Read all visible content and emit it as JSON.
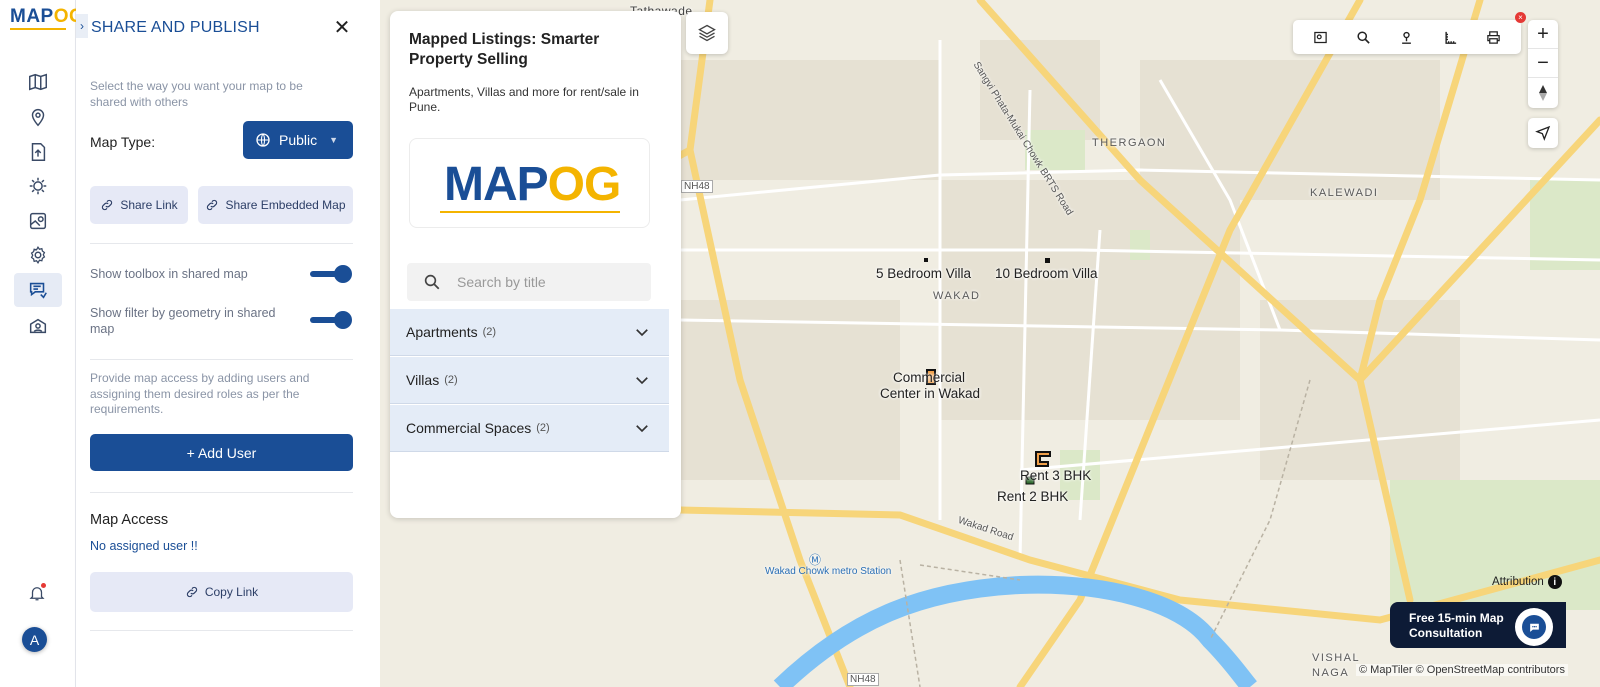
{
  "rail": {
    "logo_left": "MAP",
    "logo_right": "OG",
    "items": [
      {
        "icon": "map-icon"
      },
      {
        "icon": "location-pin-icon"
      },
      {
        "icon": "upload-icon"
      },
      {
        "icon": "settings-sun-icon"
      },
      {
        "icon": "map-analysis-icon"
      },
      {
        "icon": "gear-icon"
      },
      {
        "icon": "share-publish-icon",
        "active": true
      },
      {
        "icon": "map-access-icon"
      }
    ],
    "avatar_initial": "A"
  },
  "panel": {
    "title": "SHARE AND PUBLISH",
    "description": "Select the way you want your map to be shared with others",
    "map_type_label": "Map Type:",
    "map_type_value": "Public",
    "share_link_label": "Share Link",
    "share_embedded_label": "Share Embedded Map",
    "toggle_toolbox_label": "Show toolbox in shared map",
    "toggle_toolbox_on": true,
    "toggle_filter_label": "Show filter by geometry in shared map",
    "toggle_filter_on": true,
    "access_description": "Provide map access by adding users and assigning them desired roles as per the requirements.",
    "add_user_label": "+ Add User",
    "map_access_title": "Map Access",
    "no_user_text": "No assigned user !!",
    "copy_link_label": "Copy Link"
  },
  "card": {
    "title": "Mapped Listings: Smarter Property Selling",
    "subtitle": "Apartments, Villas and more for rent/sale in Pune.",
    "logo_left": "MAP",
    "logo_right": "OG",
    "search_placeholder": "Search by title",
    "categories": [
      {
        "label": "Apartments",
        "count": "(2)"
      },
      {
        "label": "Villas",
        "count": "(2)"
      },
      {
        "label": "Commercial Spaces",
        "count": "(2)"
      }
    ]
  },
  "map": {
    "labels": {
      "tathawade": "Tathawade",
      "thergaon": "THERGAON",
      "kalewadi": "KALEWADI",
      "wakad": "WAKAD",
      "visha": "VISHAL",
      "naga": "NAGA",
      "road_brts": "Sangvi Phata-Mukai Chowk BRTS Road",
      "road_wakad": "Wakad Road",
      "nh48_top": "NH48",
      "nh48_bottom": "NH48",
      "metro": "Wakad Chowk metro Station"
    },
    "markers": {
      "villa5": "5 Bedroom Villa",
      "villa10": "10 Bedroom Villa",
      "commercial_line1": "Commercial",
      "commercial_line2": "Center in Wakad",
      "rent3": "Rent 3 BHK",
      "rent2": "Rent 2 BHK"
    },
    "attribution": "Attribution",
    "credits": "© MapTiler © OpenStreetMap contributors",
    "consultation": "Free 15-min Map Consultation",
    "colors": {
      "primary": "#1a4e96",
      "accent": "#f4b400",
      "water": "#7fc2f5",
      "road": "#f7d57a"
    }
  }
}
